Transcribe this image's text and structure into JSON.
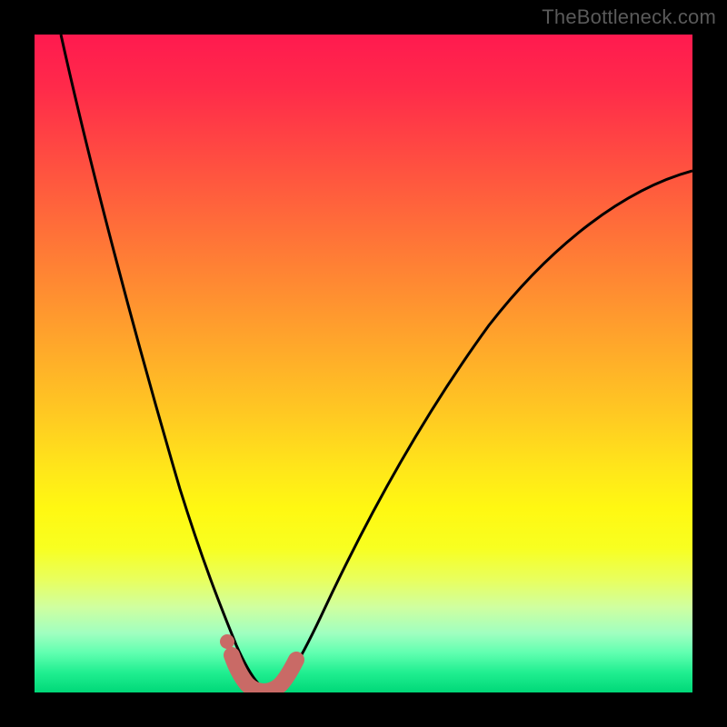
{
  "watermark": {
    "text": "TheBottleneck.com"
  },
  "chart_data": {
    "type": "line",
    "title": "",
    "xlabel": "",
    "ylabel": "",
    "xlim": [
      0,
      100
    ],
    "ylim": [
      0,
      100
    ],
    "series": [
      {
        "name": "bottleneck-curve",
        "x": [
          4,
          8,
          12,
          16,
          20,
          24,
          26,
          28,
          30,
          31,
          32,
          33,
          34,
          35,
          36,
          38,
          42,
          48,
          56,
          64,
          72,
          80,
          88,
          96,
          100
        ],
        "y": [
          100,
          85,
          70,
          55,
          40,
          25,
          18,
          12,
          6,
          3,
          1,
          0,
          0,
          0,
          1,
          4,
          12,
          24,
          38,
          50,
          59,
          66,
          72,
          77,
          79
        ]
      }
    ],
    "highlight_segment": {
      "name": "minimum-band",
      "x": [
        29,
        30,
        31,
        32,
        33,
        34,
        35,
        36,
        37
      ],
      "y": [
        5,
        3,
        1.5,
        0.5,
        0,
        0.5,
        1,
        2,
        4
      ],
      "color": "#c96a66"
    },
    "highlight_point": {
      "name": "minimum-dot",
      "x": 29.5,
      "y": 7,
      "color": "#c96a66"
    },
    "background": {
      "type": "heatmap-gradient",
      "direction": "vertical",
      "stops": [
        {
          "pos": 0.0,
          "color": "#ff1a4f"
        },
        {
          "pos": 0.5,
          "color": "#ffc822"
        },
        {
          "pos": 0.75,
          "color": "#fff812"
        },
        {
          "pos": 1.0,
          "color": "#00d878"
        }
      ]
    }
  }
}
